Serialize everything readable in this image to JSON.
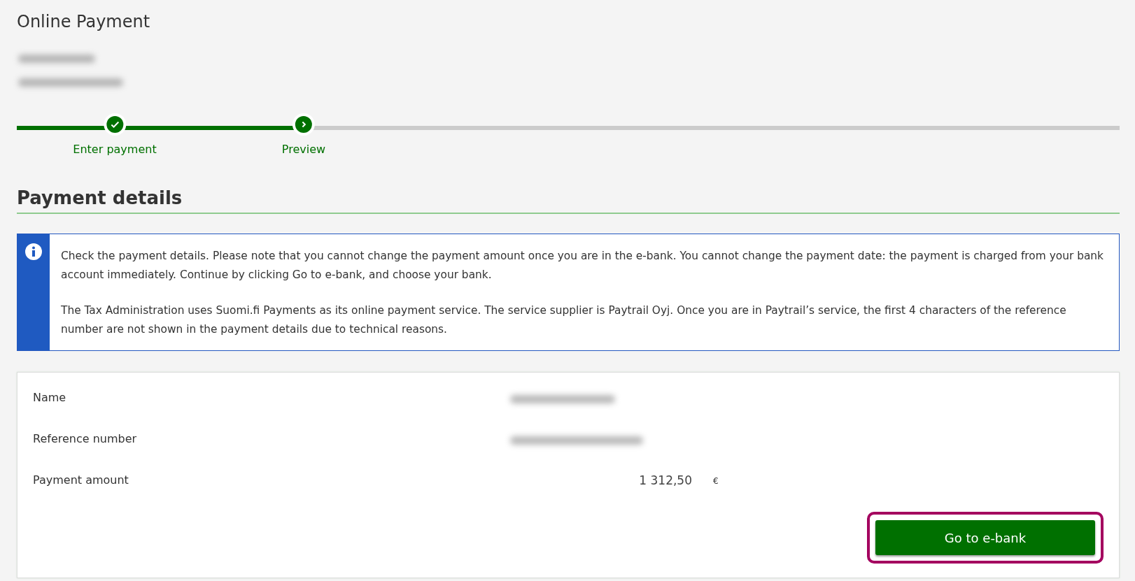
{
  "page": {
    "title": "Online Payment"
  },
  "payer_lines": [
    {
      "redacted": true
    },
    {
      "redacted": true
    }
  ],
  "steps": [
    {
      "label": "Enter payment",
      "done": true
    },
    {
      "label": "Preview",
      "done": false
    }
  ],
  "section": {
    "heading": "Payment details"
  },
  "notice": {
    "paragraphs": [
      "Check the payment details. Please note that you cannot change the payment amount once you are in the e-bank. You cannot change the payment date: the payment is charged from your bank account immediately. Continue by clicking Go to e-bank, and choose your bank.",
      "The Tax Administration uses Suomi.fi Payments as its online payment service. The service supplier is Paytrail Oyj. Once you are in Paytrail’s service, the first 4 characters of the reference number are not shown in the payment details due to technical reasons."
    ]
  },
  "details": [
    {
      "label": "Name",
      "redacted": true
    },
    {
      "label": "Reference number",
      "redacted": true
    },
    {
      "label": "Payment amount",
      "value": "1 312,50",
      "unit": "€"
    }
  ],
  "button": {
    "label": "Go to e-bank",
    "highlighted": true
  }
}
